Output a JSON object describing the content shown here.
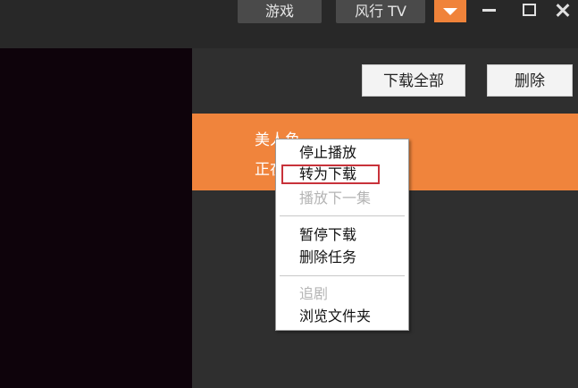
{
  "titlebar": {
    "tabs": [
      {
        "label": "游戏"
      },
      {
        "label": "风行 TV"
      }
    ],
    "dropdown_color": "#f0833a"
  },
  "toolbar": {
    "download_all_label": "下载全部",
    "delete_label": "删除"
  },
  "task": {
    "title": "美人鱼",
    "status": "正在播放",
    "highlight_color": "#f0843c"
  },
  "context_menu": {
    "items": [
      {
        "label": "停止播放",
        "enabled": true
      },
      {
        "label": "转为下载",
        "enabled": true,
        "highlighted": true
      },
      {
        "label": "播放下一集",
        "enabled": false
      },
      {
        "label": "暂停下载",
        "enabled": true
      },
      {
        "label": "删除任务",
        "enabled": true
      },
      {
        "label": "追剧",
        "enabled": false
      },
      {
        "label": "浏览文件夹",
        "enabled": true
      }
    ],
    "highlight_border_color": "#c8323a"
  }
}
